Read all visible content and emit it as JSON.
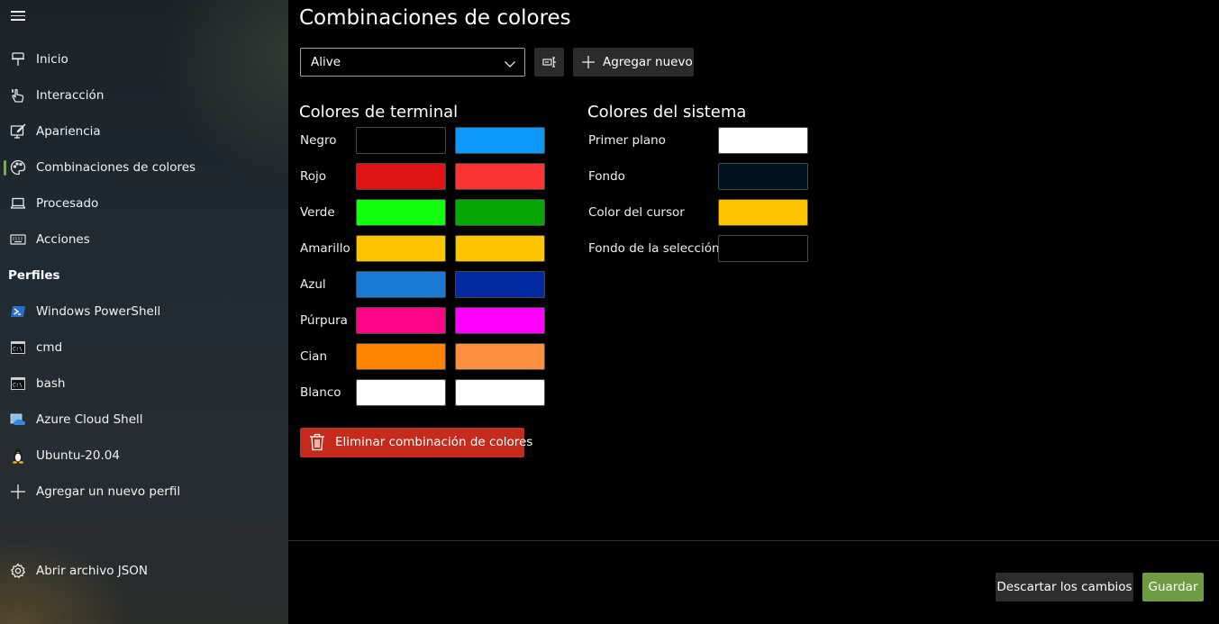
{
  "sidebar": {
    "menu_icon": "hamburger-icon",
    "items": [
      {
        "label": "Inicio",
        "icon": "pin-icon"
      },
      {
        "label": "Interacción",
        "icon": "pointer-hand-icon"
      },
      {
        "label": "Apariencia",
        "icon": "paint-monitor-icon"
      },
      {
        "label": "Combinaciones de colores",
        "icon": "palette-icon",
        "selected": true
      },
      {
        "label": "Procesado",
        "icon": "laptop-icon"
      },
      {
        "label": "Acciones",
        "icon": "keyboard-icon"
      }
    ],
    "profiles_header": "Perfiles",
    "profiles": [
      {
        "label": "Windows PowerShell",
        "icon": "powershell-icon"
      },
      {
        "label": "cmd",
        "icon": "cmd-icon"
      },
      {
        "label": "bash",
        "icon": "cmd-icon"
      },
      {
        "label": "Azure Cloud Shell",
        "icon": "azure-cloud-icon"
      },
      {
        "label": "Ubuntu-20.04",
        "icon": "linux-tux-icon"
      }
    ],
    "add_profile": "Agregar un nuevo perfil",
    "open_json": "Abrir archivo JSON"
  },
  "main": {
    "title": "Combinaciones de colores",
    "scheme_select": {
      "value": "Alive"
    },
    "add_new_label": "Agregar nuevo",
    "terminal_colors": {
      "title": "Colores de terminal",
      "rows": [
        {
          "label": "Negro",
          "normal": "#000000",
          "bright": "#0e98fb"
        },
        {
          "label": "Rojo",
          "normal": "#e01414",
          "bright": "#fa3434"
        },
        {
          "label": "Verde",
          "normal": "#12ff12",
          "bright": "#06a606"
        },
        {
          "label": "Amarillo",
          "normal": "#ffc500",
          "bright": "#ffc400"
        },
        {
          "label": "Azul",
          "normal": "#1a79d2",
          "bright": "#02299f"
        },
        {
          "label": "Púrpura",
          "normal": "#ff0486",
          "bright": "#ff00ff"
        },
        {
          "label": "Cian",
          "normal": "#ff8400",
          "bright": "#ff8f40"
        },
        {
          "label": "Blanco",
          "normal": "#ffffff",
          "bright": "#ffffff"
        }
      ]
    },
    "system_colors": {
      "title": "Colores del sistema",
      "rows": [
        {
          "label": "Primer plano",
          "color": "#ffffff"
        },
        {
          "label": "Fondo",
          "color": "#00121e"
        },
        {
          "label": "Color del cursor",
          "color": "#ffc500"
        },
        {
          "label": "Fondo de la selección",
          "color": "#000000"
        }
      ]
    },
    "delete_label": "Eliminar combinación de colores",
    "discard_label": "Descartar los cambios",
    "save_label": "Guardar"
  },
  "colors": {
    "accent": "#7fa658",
    "save": "#6f9b45",
    "delete": "#c42b1c"
  }
}
